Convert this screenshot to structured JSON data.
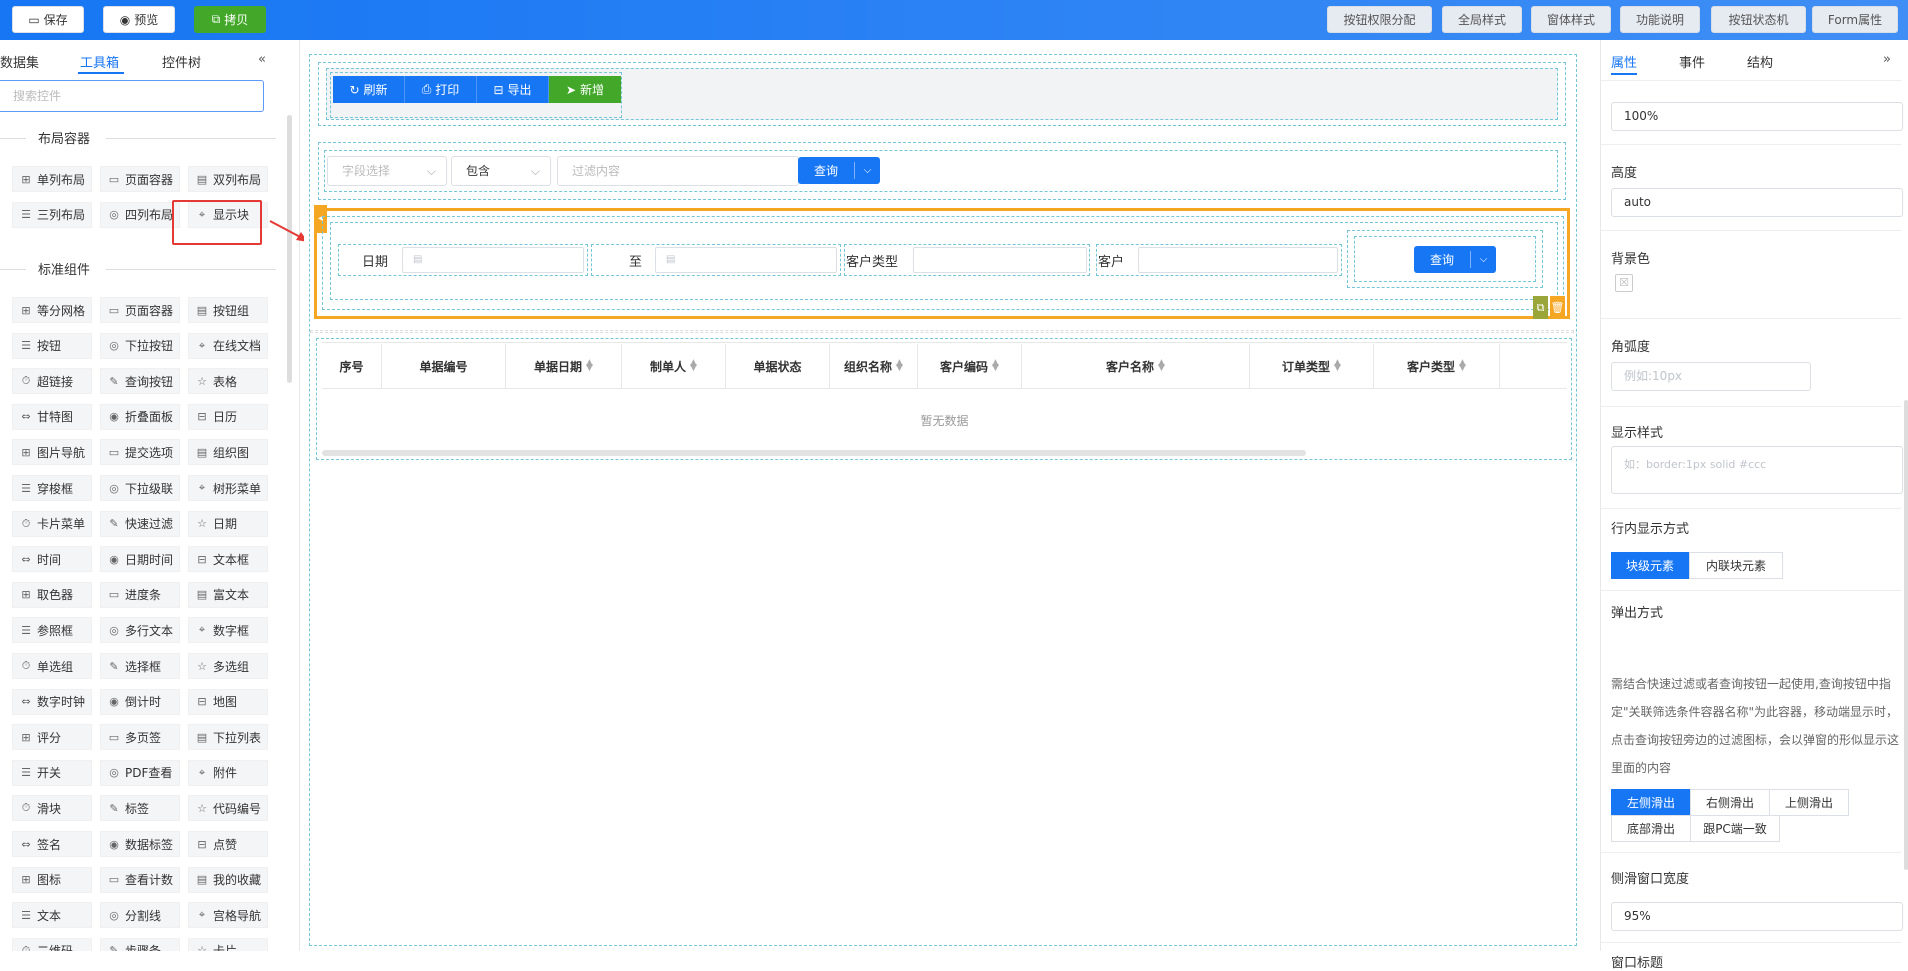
{
  "toolbar": {
    "save": "保存",
    "preview": "预览",
    "copy": "拷贝",
    "right_buttons": [
      "按钮权限分配",
      "全局样式",
      "窗体样式",
      "功能说明",
      "按钮状态机",
      "Form属性"
    ]
  },
  "left_panel": {
    "tabs": [
      "数据集",
      "工具箱",
      "控件树"
    ],
    "active_tab": "工具箱",
    "collapse_icon": "double-chevron-left-icon",
    "search_placeholder": "搜索控件",
    "sections": {
      "layout": "布局容器",
      "standard": "标准组件"
    },
    "layout_tools": [
      "单列布局",
      "页面容器",
      "双列布局",
      "三列布局",
      "四列布局",
      "显示块"
    ],
    "standard_tools": [
      "等分网格",
      "页面容器",
      "按钮组",
      "按钮",
      "下拉按钮",
      "在线文档",
      "超链接",
      "查询按钮",
      "表格",
      "甘特图",
      "折叠面板",
      "日历",
      "图片导航",
      "提交选项",
      "组织图",
      "穿梭框",
      "下拉级联",
      "树形菜单",
      "卡片菜单",
      "快速过滤",
      "日期",
      "时间",
      "日期时间",
      "文本框",
      "取色器",
      "进度条",
      "富文本",
      "参照框",
      "多行文本",
      "数字框",
      "单选组",
      "选择框",
      "多选组",
      "数字时钟",
      "倒计时",
      "地图",
      "评分",
      "多页签",
      "下拉列表",
      "开关",
      "PDF查看",
      "附件",
      "滑块",
      "标签",
      "代码编号",
      "签名",
      "数据标签",
      "点赞",
      "图标",
      "查看计数",
      "我的收藏",
      "文本",
      "分割线",
      "宫格导航",
      "二维码",
      "步骤条",
      "卡片"
    ]
  },
  "canvas": {
    "button_bar": [
      "刷新",
      "打印",
      "导出",
      "新增"
    ],
    "filter": {
      "field_placeholder": "字段选择",
      "operator": "包含",
      "value_placeholder": "过滤内容",
      "query": "查询"
    },
    "query_form": {
      "date_label": "日期",
      "to_label": "至",
      "customer_type_label": "客户类型",
      "customer_label": "客户",
      "query": "查询"
    },
    "table": {
      "columns": [
        "序号",
        "单据编号",
        "单据日期",
        "制单人",
        "单据状态",
        "组织名称",
        "客户编码",
        "客户名称",
        "订单类型",
        "客户类型"
      ],
      "sortable": [
        false,
        false,
        true,
        true,
        false,
        true,
        true,
        true,
        true,
        true
      ],
      "empty_text": "暂无数据"
    }
  },
  "right_panel": {
    "tabs": [
      "属性",
      "事件",
      "结构"
    ],
    "active_tab": "属性",
    "expand_icon": "double-chevron-right-icon",
    "width_value": "100%",
    "height_label": "高度",
    "height_value": "auto",
    "bg_label": "背景色",
    "radius_label": "角弧度",
    "radius_placeholder": "例如:10px",
    "style_label": "显示样式",
    "style_placeholder": "如：border:1px solid #ccc",
    "inline_label": "行内显示方式",
    "inline_options": [
      "块级元素",
      "内联块元素"
    ],
    "inline_selected": "块级元素",
    "popup_label": "弹出方式",
    "popup_desc": "需结合快速过滤或者查询按钮一起使用,查询按钮中指定\"关联筛选条件容器名称\"为此容器，移动端显示时，点击查询按钮旁边的过滤图标，会以弹窗的形似显示这里面的内容",
    "popup_options": [
      "左侧滑出",
      "右侧滑出",
      "上侧滑出",
      "底部滑出",
      "跟PC端一致"
    ],
    "popup_selected": "左侧滑出",
    "side_width_label": "侧滑窗口宽度",
    "side_width_value": "95%",
    "window_title_label": "窗口标题"
  },
  "colors": {
    "primary": "#1676f3",
    "success": "#43a82a",
    "highlight": "#f5a623",
    "annotation": "#e53935"
  }
}
